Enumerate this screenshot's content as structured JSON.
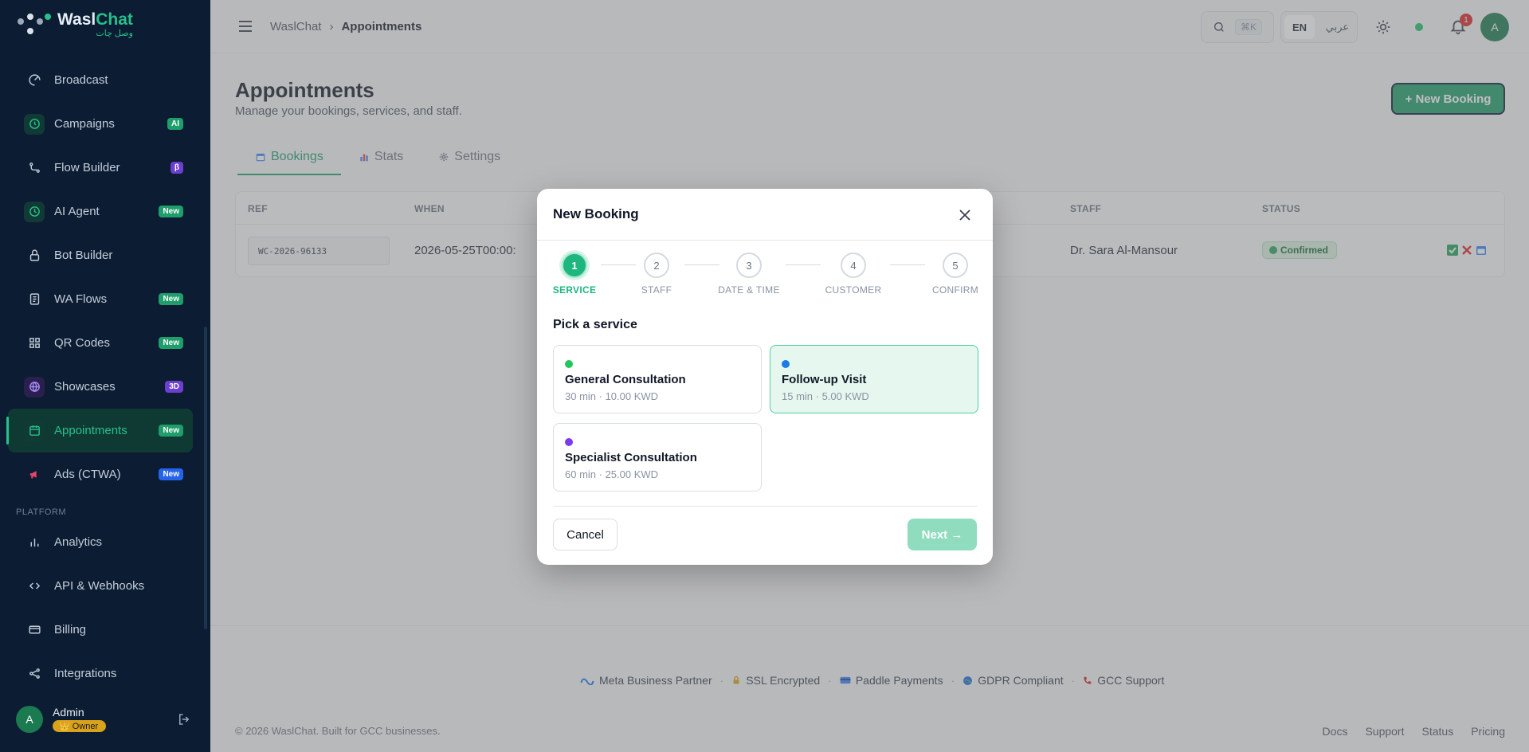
{
  "brand": {
    "name_part1": "Wasl",
    "name_part2": "Chat",
    "name_arabic": "وصل چات",
    "accent_color": "#1f9d6a"
  },
  "sidebar": {
    "items": [
      {
        "label": "Broadcast",
        "icon": "broadcast-icon",
        "badge": ""
      },
      {
        "label": "Campaigns",
        "icon": "campaign-icon",
        "badge": "AI"
      },
      {
        "label": "Flow Builder",
        "icon": "flow-icon",
        "badge": "β"
      },
      {
        "label": "AI Agent",
        "icon": "clock-icon",
        "badge": "New"
      },
      {
        "label": "Bot Builder",
        "icon": "lock-icon",
        "badge": ""
      },
      {
        "label": "WA Flows",
        "icon": "doc-icon",
        "badge": "New"
      },
      {
        "label": "QR Codes",
        "icon": "qr-icon",
        "badge": "New"
      },
      {
        "label": "Showcases",
        "icon": "globe-icon",
        "badge": "3D"
      },
      {
        "label": "Appointments",
        "icon": "calendar-icon",
        "badge": "New"
      },
      {
        "label": "Ads (CTWA)",
        "icon": "megaphone-icon",
        "badge": "New"
      }
    ],
    "section_platform": "PLATFORM",
    "platform_items": [
      {
        "label": "Analytics",
        "icon": "chart-icon"
      },
      {
        "label": "API & Webhooks",
        "icon": "code-icon"
      },
      {
        "label": "Billing",
        "icon": "card-icon"
      },
      {
        "label": "Integrations",
        "icon": "share-icon"
      }
    ],
    "user": {
      "initial": "A",
      "name": "Admin",
      "role": "Owner"
    }
  },
  "topbar": {
    "breadcrumb_root": "WaslChat",
    "breadcrumb_current": "Appointments",
    "search_shortcut": "⌘K",
    "lang_en": "EN",
    "lang_ar": "عربي",
    "notifications": "1",
    "avatar_initial": "A"
  },
  "page": {
    "title": "Appointments",
    "subtitle": "Manage your bookings, services, and staff.",
    "new_booking": "+ New Booking",
    "tabs": [
      {
        "label": "Bookings",
        "active": true
      },
      {
        "label": "Stats",
        "active": false
      },
      {
        "label": "Settings",
        "active": false
      }
    ],
    "table": {
      "headers": {
        "ref": "REF",
        "when": "WHEN",
        "staff": "STAFF",
        "status": "STATUS"
      },
      "rows": [
        {
          "ref": "WC-2026-96133",
          "when": "2026-05-25T00:00:",
          "staff": "Dr. Sara Al-Mansour",
          "status": "Confirmed"
        }
      ]
    }
  },
  "footer": {
    "trust": [
      "Meta Business Partner",
      "SSL Encrypted",
      "Paddle Payments",
      "GDPR Compliant",
      "GCC Support"
    ],
    "copyright": "© 2026 WaslChat. Built for GCC businesses.",
    "links": [
      "Docs",
      "Support",
      "Status",
      "Pricing"
    ]
  },
  "modal": {
    "title": "New Booking",
    "steps": [
      {
        "num": "1",
        "label": "SERVICE"
      },
      {
        "num": "2",
        "label": "STAFF"
      },
      {
        "num": "3",
        "label": "DATE & TIME"
      },
      {
        "num": "4",
        "label": "CUSTOMER"
      },
      {
        "num": "5",
        "label": "CONFIRM"
      }
    ],
    "active_step": 1,
    "pick_label": "Pick a service",
    "services": [
      {
        "name": "General Consultation",
        "meta": "30 min · 10.00 KWD",
        "color": "#22c55e",
        "selected": false
      },
      {
        "name": "Follow-up Visit",
        "meta": "15 min · 5.00 KWD",
        "color": "#2563eb",
        "selected": true
      },
      {
        "name": "Specialist Consultation",
        "meta": "60 min · 25.00 KWD",
        "color": "#7c3aed",
        "selected": false
      }
    ],
    "cancel": "Cancel",
    "next": "Next →"
  }
}
